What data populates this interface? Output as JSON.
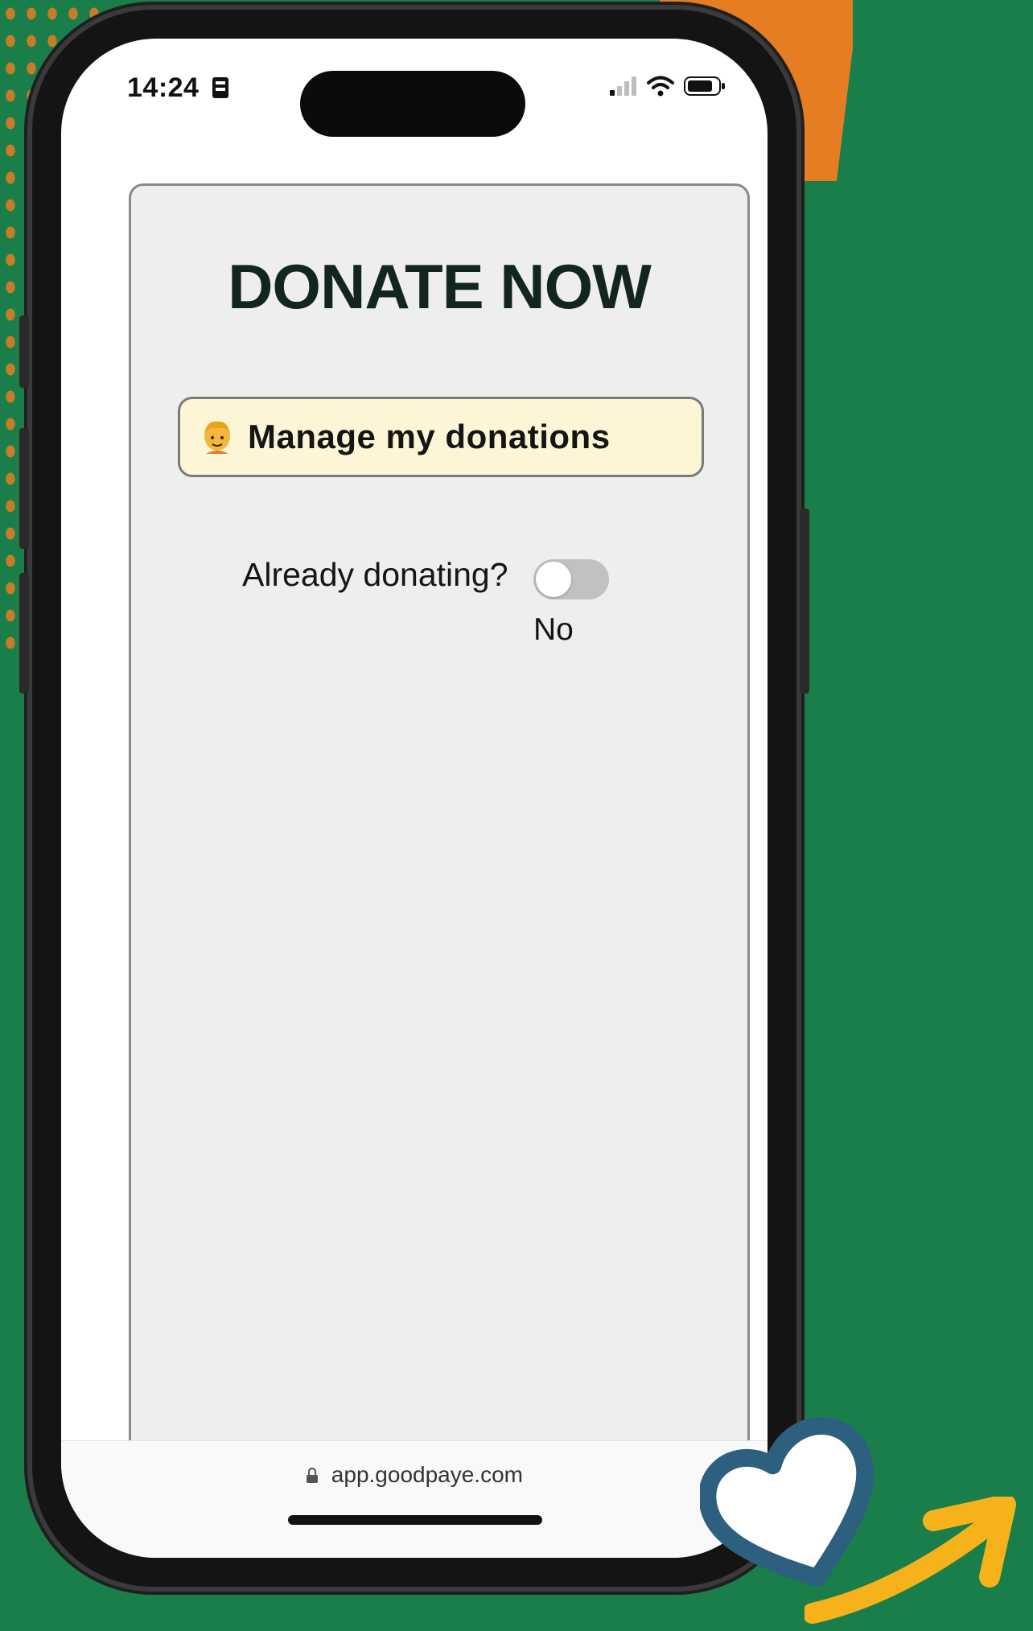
{
  "status_bar": {
    "time": "14:24"
  },
  "page": {
    "title": "DONATE NOW",
    "manage_button_label": "Manage my donations",
    "already_donating_label": "Already donating?",
    "toggle_state": "No"
  },
  "browser": {
    "url": "app.goodpaye.com"
  },
  "colors": {
    "background": "#1a7e4b",
    "button_bg": "#fdf6d6",
    "title": "#12261e"
  },
  "icons": [
    "person-emoji-icon",
    "lock-icon",
    "signal-icon",
    "wifi-icon",
    "battery-icon",
    "heart-icon",
    "arrow-icon"
  ]
}
